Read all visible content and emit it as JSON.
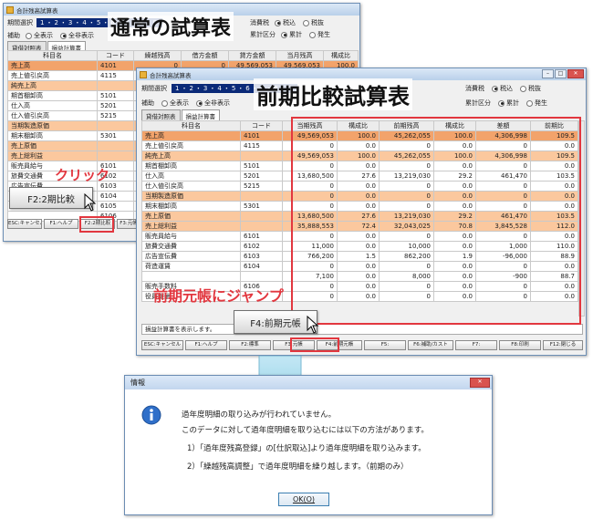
{
  "back": {
    "title": "合計残高試算表",
    "period_label": "期間選択",
    "period_value": "1・2・3・4・5・6・7・8・9",
    "tax_label": "消費税",
    "tax_options": [
      "税込",
      "税抜"
    ],
    "calc_label": "累計区分",
    "calc_options": [
      "累計",
      "発生"
    ],
    "aux_label": "補助",
    "aux_options": [
      "全表示",
      "全非表示"
    ],
    "tabs": [
      "貸借対照表",
      "損益計算書"
    ],
    "columns": [
      "科目名",
      "コード",
      "繰越残高",
      "借方金額",
      "貸方金額",
      "当月残高",
      "構成比"
    ],
    "rows": [
      {
        "name": "売上高",
        "code": "4101",
        "v": [
          "0",
          "0",
          "49,569,053",
          "49,569,053",
          "100.0"
        ],
        "style": "sel"
      },
      {
        "name": "売上値引戻高",
        "code": "4115",
        "v": [
          "",
          "",
          "",
          "",
          ""
        ],
        "style": ""
      },
      {
        "name": "純売上高",
        "code": "",
        "v": [
          "",
          "",
          "",
          "",
          ""
        ],
        "style": "hl"
      },
      {
        "name": "期首棚卸高",
        "code": "5101",
        "v": [
          "",
          "",
          "",
          "",
          ""
        ],
        "style": ""
      },
      {
        "name": "仕入高",
        "code": "5201",
        "v": [
          "",
          "",
          "",
          "",
          ""
        ],
        "style": ""
      },
      {
        "name": "仕入値引戻高",
        "code": "5215",
        "v": [
          "",
          "",
          "",
          "",
          ""
        ],
        "style": ""
      },
      {
        "name": "当期製造原価",
        "code": "",
        "v": [
          "",
          "",
          "",
          "",
          ""
        ],
        "style": "hl"
      },
      {
        "name": "期末棚卸高",
        "code": "5301",
        "v": [
          "",
          "",
          "",
          "",
          ""
        ],
        "style": ""
      },
      {
        "name": "売上原価",
        "code": "",
        "v": [
          "",
          "",
          "",
          "",
          ""
        ],
        "style": "hl"
      },
      {
        "name": "売上総利益",
        "code": "",
        "v": [
          "",
          "",
          "",
          "",
          ""
        ],
        "style": "hl"
      },
      {
        "name": "販売員給与",
        "code": "6101",
        "v": [
          "",
          "",
          "",
          "",
          ""
        ],
        "style": ""
      },
      {
        "name": "旅費交通費",
        "code": "6102",
        "v": [
          "",
          "",
          "",
          "",
          ""
        ],
        "style": ""
      },
      {
        "name": "広告宣伝費",
        "code": "6103",
        "v": [
          "",
          "",
          "",
          "",
          ""
        ],
        "style": ""
      },
      {
        "name": "管理諸費",
        "code": "6104",
        "v": [
          "",
          "",
          "",
          "",
          ""
        ],
        "style": ""
      },
      {
        "name": "",
        "code": "6105",
        "v": [
          "",
          "",
          "",
          "",
          ""
        ],
        "style": ""
      },
      {
        "name": "",
        "code": "6106",
        "v": [
          "",
          "",
          "",
          "",
          ""
        ],
        "style": ""
      }
    ],
    "fkeys": [
      "ESC:キャンセル",
      "F1:ヘルプ",
      "F2:2期比較",
      "F3:元帳"
    ]
  },
  "front": {
    "title": "合計残高試算表",
    "period_label": "期間選択",
    "period_value": "1・2・3・4・5・6・7・8・9",
    "tax_label": "消費税",
    "tax_options": [
      "税込",
      "税抜"
    ],
    "calc_label": "累計区分",
    "calc_options": [
      "累計",
      "発生"
    ],
    "aux_label": "補助",
    "aux_options": [
      "全表示",
      "全非表示"
    ],
    "tabs": [
      "貸借対照表",
      "損益計算書"
    ],
    "columns": [
      "科目名",
      "コード",
      "当期残高",
      "構成比",
      "前期残高",
      "構成比",
      "差額",
      "前期比"
    ],
    "rows": [
      {
        "name": "売上高",
        "code": "4101",
        "v": [
          "49,569,053",
          "100.0",
          "45,262,055",
          "100.0",
          "4,306,998",
          "109.5"
        ],
        "style": "sel"
      },
      {
        "name": "売上値引戻高",
        "code": "4115",
        "v": [
          "0",
          "0.0",
          "0",
          "0.0",
          "0",
          "0.0"
        ],
        "style": ""
      },
      {
        "name": "純売上高",
        "code": "",
        "v": [
          "49,569,053",
          "100.0",
          "45,262,055",
          "100.0",
          "4,306,998",
          "109.5"
        ],
        "style": "hl"
      },
      {
        "name": "期首棚卸高",
        "code": "5101",
        "v": [
          "0",
          "0.0",
          "0",
          "0.0",
          "0",
          "0.0"
        ],
        "style": ""
      },
      {
        "name": "仕入高",
        "code": "5201",
        "v": [
          "13,680,500",
          "27.6",
          "13,219,030",
          "29.2",
          "461,470",
          "103.5"
        ],
        "style": ""
      },
      {
        "name": "仕入値引戻高",
        "code": "5215",
        "v": [
          "0",
          "0.0",
          "0",
          "0.0",
          "0",
          "0.0"
        ],
        "style": ""
      },
      {
        "name": "当期製造原価",
        "code": "",
        "v": [
          "0",
          "0.0",
          "0",
          "0.0",
          "0",
          "0.0"
        ],
        "style": "hl"
      },
      {
        "name": "期末棚卸高",
        "code": "5301",
        "v": [
          "0",
          "0.0",
          "0",
          "0.0",
          "0",
          "0.0"
        ],
        "style": ""
      },
      {
        "name": "売上原価",
        "code": "",
        "v": [
          "13,680,500",
          "27.6",
          "13,219,030",
          "29.2",
          "461,470",
          "103.5"
        ],
        "style": "hl"
      },
      {
        "name": "売上総利益",
        "code": "",
        "v": [
          "35,888,553",
          "72.4",
          "32,043,025",
          "70.8",
          "3,845,528",
          "112.0"
        ],
        "style": "hl"
      },
      {
        "name": "販売員給与",
        "code": "6101",
        "v": [
          "0",
          "0.0",
          "0",
          "0.0",
          "0",
          "0.0"
        ],
        "style": ""
      },
      {
        "name": "旅費交通費",
        "code": "6102",
        "v": [
          "11,000",
          "0.0",
          "10,000",
          "0.0",
          "1,000",
          "110.0"
        ],
        "style": ""
      },
      {
        "name": "広告宣伝費",
        "code": "6103",
        "v": [
          "766,200",
          "1.5",
          "862,200",
          "1.9",
          "-96,000",
          "88.9"
        ],
        "style": ""
      },
      {
        "name": "荷造運賃",
        "code": "6104",
        "v": [
          "0",
          "0.0",
          "0",
          "0.0",
          "0",
          "0.0"
        ],
        "style": ""
      },
      {
        "name": "",
        "code": "",
        "v": [
          "7,100",
          "0.0",
          "8,000",
          "0.0",
          "-900",
          "88.7"
        ],
        "style": ""
      },
      {
        "name": "販売手数料",
        "code": "6106",
        "v": [
          "0",
          "0.0",
          "0",
          "0.0",
          "0",
          "0.0"
        ],
        "style": ""
      },
      {
        "name": "役員報酬",
        "code": "",
        "v": [
          "0",
          "0.0",
          "0",
          "0.0",
          "0",
          "0.0"
        ],
        "style": ""
      }
    ],
    "status_text": "損益計算書を表示します。",
    "fkeys": [
      "ESC:キャンセル",
      "F1:ヘルプ",
      "F2:標準",
      "F3:元帳",
      "F4:前期元帳",
      "F5:",
      "F6:補助/カスト",
      "F7:",
      "F8:印刷",
      "F12:閉じる"
    ]
  },
  "annotations": {
    "back_title": "通常の試算表",
    "front_title": "前期比較試算表",
    "click": "クリック",
    "f2_button": "F2:2期比較",
    "jump": "前期元帳にジャンプ",
    "f4_button": "F4:前期元帳"
  },
  "dialog": {
    "title": "情報",
    "line1": "過年度明細の取り込みが行われていません。",
    "line2": "このデータに対して過年度明細を取り込むには以下の方法があります。",
    "item1": "1）「過年度残高登録」の[仕訳取込]より過年度明細を取り込みます。",
    "item2": "2）「繰越残高調整」で過年度明細を繰り越します。（前期のみ）",
    "ok": "OK(O)"
  },
  "colors": {
    "highlight": "#fbc89e",
    "selected": "#f2a36b",
    "callout": "#e2373f",
    "arrow": "#8ccfe6"
  }
}
